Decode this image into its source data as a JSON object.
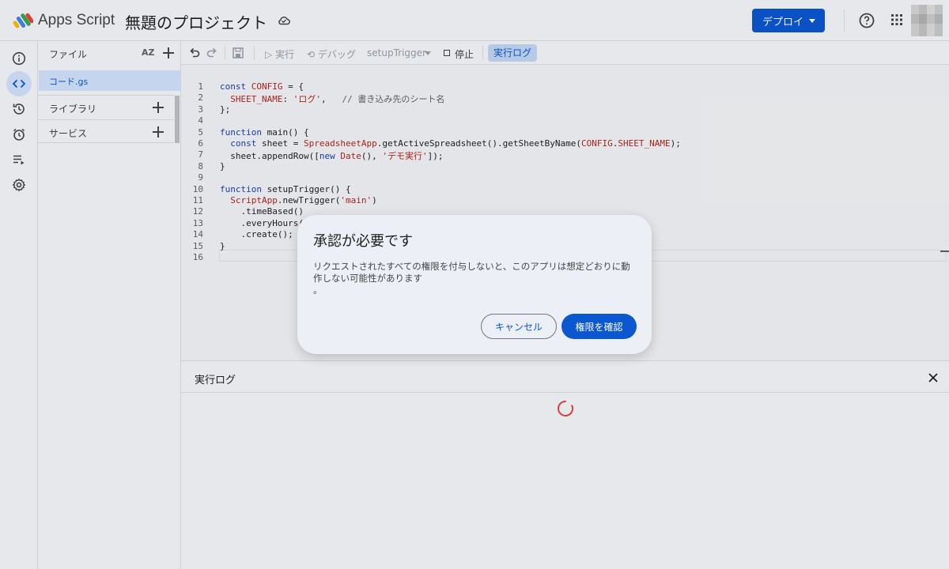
{
  "header": {
    "app_name": "Apps Script",
    "project_title": "無題のプロジェクト",
    "deploy_label": "デプロイ"
  },
  "rail": {
    "items": [
      "info-icon",
      "code-icon",
      "history-icon",
      "alarm-icon",
      "executions-icon",
      "settings-icon"
    ],
    "active": "code-icon"
  },
  "files": {
    "title": "ファイル",
    "sort_label": "AZ",
    "items": [
      {
        "label": "コード.gs"
      }
    ],
    "sections": [
      {
        "label": "ライブラリ"
      },
      {
        "label": "サービス"
      }
    ]
  },
  "toolbar": {
    "run_label": "実行",
    "debug_label": "デバッグ",
    "function_select": "setupTrigger",
    "stop_label": "停止",
    "log_label": "実行ログ"
  },
  "editor": {
    "line_numbers": [
      "1",
      "2",
      "3",
      "4",
      "5",
      "6",
      "7",
      "8",
      "9",
      "10",
      "11",
      "12",
      "13",
      "14",
      "15",
      "16"
    ],
    "lines": [
      "const CONFIG = {",
      "  SHEET_NAME: 'ログ',   // 書き込み先のシート名",
      "};",
      "",
      "function main() {",
      "  const sheet = SpreadsheetApp.getActiveSpreadsheet().getSheetByName(CONFIG.SHEET_NAME);",
      "  sheet.appendRow([new Date(), 'デモ実行']);",
      "}",
      "",
      "function setupTrigger() {",
      "  ScriptApp.newTrigger('main')",
      "    .timeBased()",
      "    .everyHours(",
      "    .create();",
      "}",
      ""
    ]
  },
  "log_panel": {
    "title": "実行ログ"
  },
  "dialog": {
    "title": "承認が必要です",
    "body": "リクエストされたすべての権限を付与しないと、このアプリは想定どおりに動作しない可能性があります\n。",
    "cancel_label": "キャンセル",
    "confirm_label": "権限を確認"
  },
  "colors": {
    "primary": "#0b57d0",
    "active_bg": "#d3e3fd",
    "dialog_bg": "#eceff6",
    "keyword": "#1a3fb6",
    "string": "#b3261e"
  }
}
